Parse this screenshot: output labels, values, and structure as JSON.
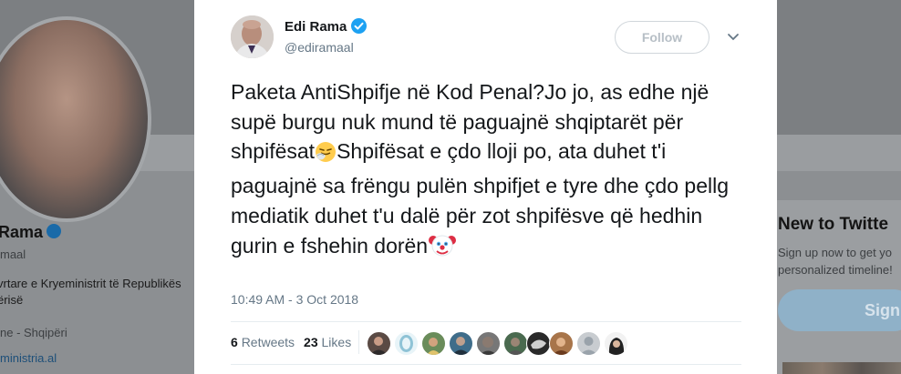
{
  "background": {
    "profile_name": "Rama",
    "profile_handle": "maal",
    "bio": "vrtare e Kryeministrit të Republikës\nërisë",
    "location": "ne - Shqipëri",
    "link": "ministria.al",
    "sidebar_title": "New to Twitte",
    "sidebar_text": "Sign up now to get yo\npersonalized timeline!",
    "signup_button": "Sign"
  },
  "tweet": {
    "author_name": "Edi Rama",
    "author_handle": "@ediramaal",
    "follow_label": "Follow",
    "text_part1": "Paketa AntiShpifje në Kod Penal?Jo jo, as edhe një supë burgu nuk mund të paguajnë shqiptarët për shpifësat",
    "text_part2": "Shpifësat e çdo lloji po, ata duhet t'i paguajnë sa frëngu pulën shpifjet e tyre dhe çdo pellg mediatik duhet t'u dalë për zot shpifësve që hedhin gurin e fshehin dorën",
    "timestamp": "10:49 AM - 3 Oct 2018",
    "retweets_count": "6",
    "retweets_label": "Retweets",
    "likes_count": "23",
    "likes_label": "Likes",
    "colors": {
      "verified": "#1da1f2",
      "text": "#14171a",
      "muted": "#657786"
    },
    "icons": [
      "verified-badge-icon",
      "chevron-down-icon",
      "sneezing-face-emoji",
      "clown-face-emoji"
    ]
  }
}
